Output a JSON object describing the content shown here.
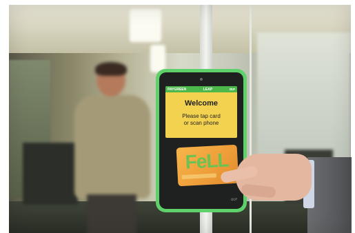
{
  "reader": {
    "top_left": "PAYGREEN",
    "top_mid": "LEAP",
    "top_right": "ɑʊᵖ",
    "welcome": "Welcome",
    "line1": "Please tap card",
    "line2": "or scan phone",
    "brand": "ɑʊᵖ"
  },
  "card": {
    "logo": "FeLL"
  },
  "colors": {
    "reader_body": "#5fd16a",
    "screen": "#f3d250",
    "card": "#f0a63f"
  }
}
